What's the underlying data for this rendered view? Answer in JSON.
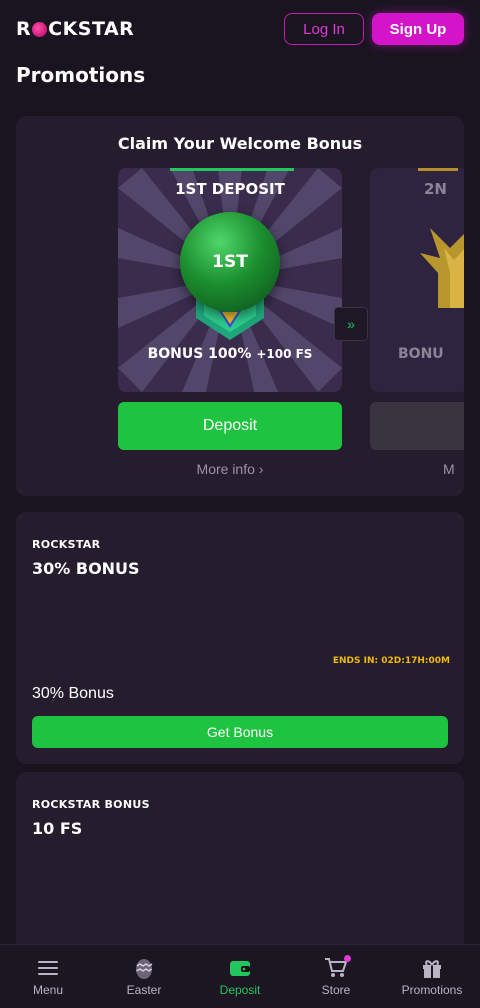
{
  "header": {
    "logo_prefix": "R",
    "logo_suffix": "CKSTAR",
    "login_label": "Log In",
    "signup_label": "Sign Up"
  },
  "page_title": "Promotions",
  "welcome": {
    "title": "Claim Your Welcome Bonus",
    "slides": [
      {
        "heading": "1ST DEPOSIT",
        "badge": "1ST",
        "bonus_main": "BONUS 100%",
        "bonus_extra": "+100 FS",
        "button_label": "Deposit",
        "more_info": "More info ›"
      },
      {
        "heading": "2N",
        "bonus_main": "BONU",
        "more_info": "M"
      }
    ],
    "next_icon": "double-chevron-right-icon"
  },
  "promos": [
    {
      "brand": "ROCKSTAR",
      "title": "30% BONUS",
      "ends_in": "ENDS IN: 02D:17H:00M",
      "description": "30% Bonus",
      "button_label": "Get Bonus"
    },
    {
      "brand": "ROCKSTAR BONUS",
      "title": "10 FS"
    }
  ],
  "nav": [
    {
      "label": "Menu",
      "icon": "hamburger-icon"
    },
    {
      "label": "Easter",
      "icon": "easter-egg-icon"
    },
    {
      "label": "Deposit",
      "icon": "wallet-icon"
    },
    {
      "label": "Store",
      "icon": "cart-icon"
    },
    {
      "label": "Promotions",
      "icon": "gift-icon"
    }
  ],
  "colors": {
    "background": "#1a1421",
    "card": "#251d2e",
    "accent_pink": "#d414c8",
    "accent_green": "#1ec33f",
    "timer_yellow": "#f0b90b"
  }
}
